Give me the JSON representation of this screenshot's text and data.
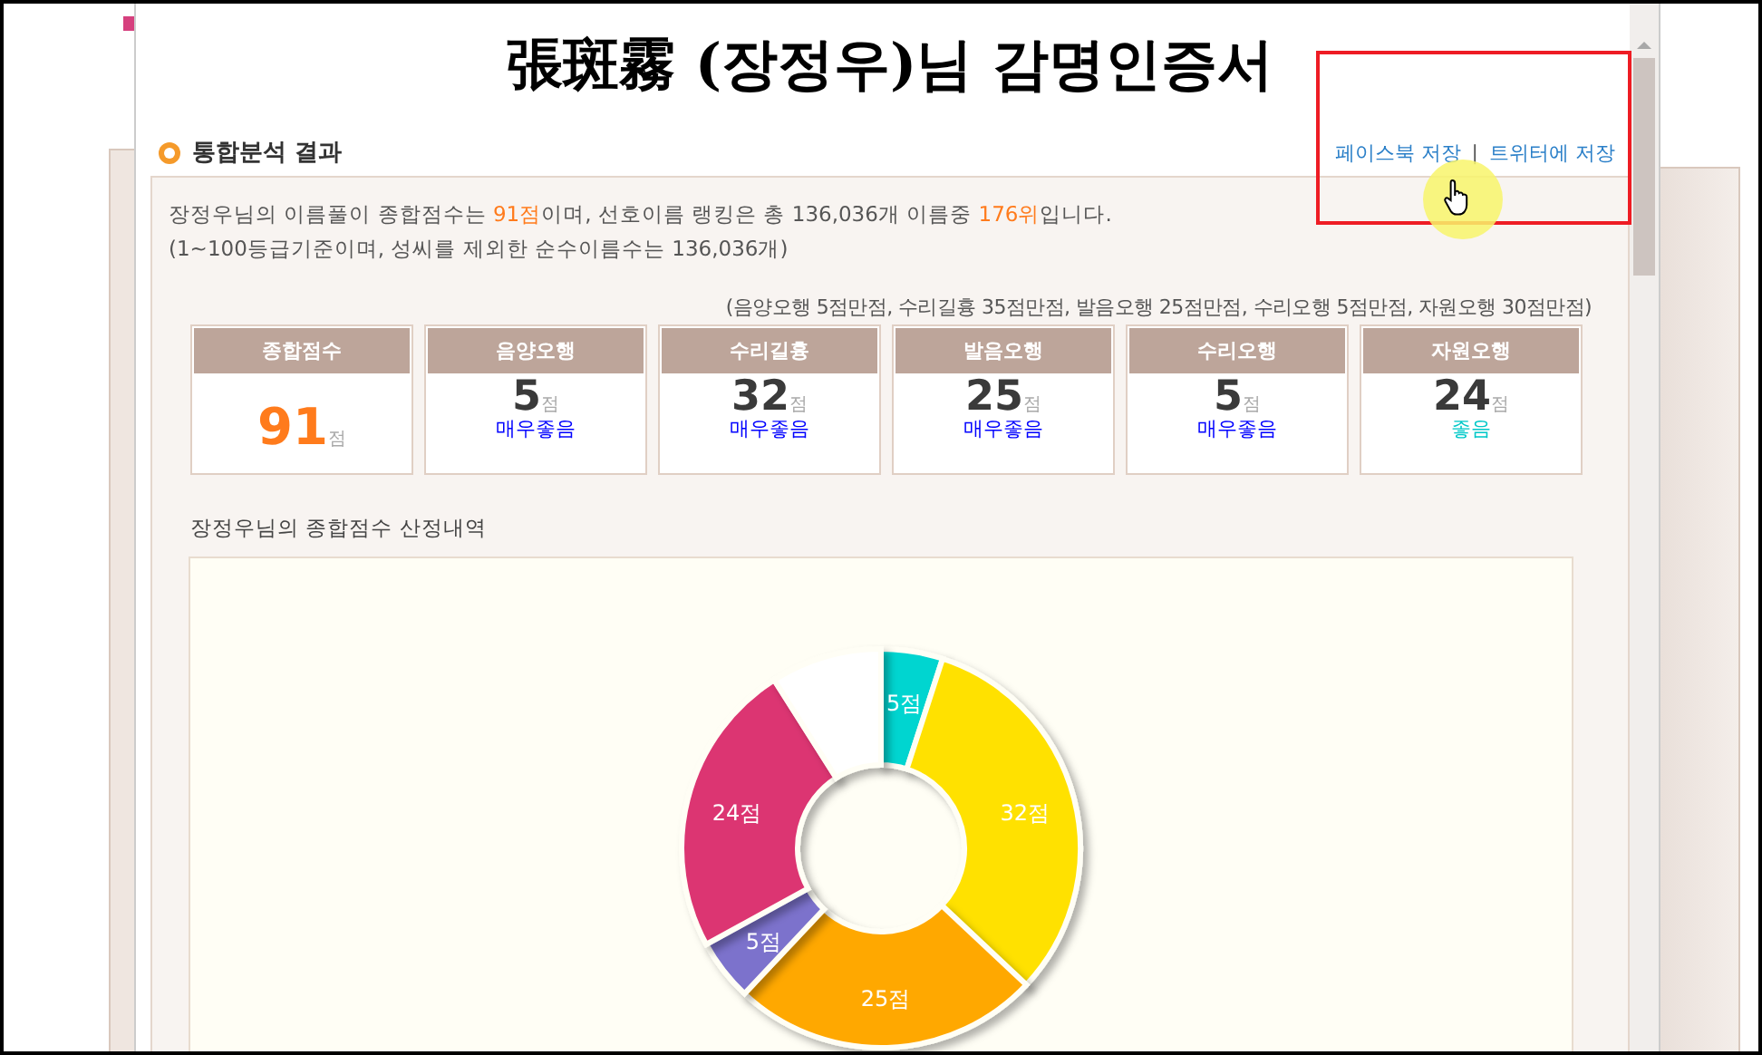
{
  "title": "張斑霧 (장정우)님 감명인증서",
  "section": {
    "title": "통합분석 결과",
    "links": [
      "페이스북 저장",
      "트위터에 저장"
    ],
    "separator": "|"
  },
  "summary": {
    "line1": "장정우님의 이름풀이 종합점수는 **91점**이며, 선호이름 랭킹은 총 136,036개 이름중 **176위**입니다.",
    "line2": "(1~100등급기준이며, 성씨를 제외한 순수이름수는 136,036개)"
  },
  "max_note": "(음양오행 5점만점, 수리길흉 35점만점, 발음오행 25점만점, 수리오행 5점만점, 자원오행 30점만점)",
  "cards": [
    {
      "kind": "total",
      "title": "종합점수",
      "score": "91",
      "unit": "점"
    },
    {
      "kind": "part",
      "title": "음양오행",
      "score": "5",
      "unit": "점",
      "grade": "매우좋음",
      "color": "#0000ff"
    },
    {
      "kind": "part",
      "title": "수리길흉",
      "score": "32",
      "unit": "점",
      "grade": "매우좋음",
      "color": "#0000ff"
    },
    {
      "kind": "part",
      "title": "발음오행",
      "score": "25",
      "unit": "점",
      "grade": "매우좋음",
      "color": "#0000ff"
    },
    {
      "kind": "part",
      "title": "수리오행",
      "score": "5",
      "unit": "점",
      "grade": "매우좋음",
      "color": "#0000ff"
    },
    {
      "kind": "part",
      "title": "자원오행",
      "score": "24",
      "unit": "점",
      "grade": "좋음",
      "color": "#00c8c8"
    }
  ],
  "breakdown": {
    "title": "장정우님의 종합점수 산정내역",
    "chart_data": {
      "type": "donut",
      "values": [
        5,
        32,
        25,
        5,
        24,
        9
      ],
      "colors": [
        "#00d5d0",
        "#ffe100",
        "#ffa800",
        "#7b72cc",
        "#dc3672",
        "#ffffff"
      ],
      "value_labels": [
        "5점",
        "32점",
        "25점",
        "5점",
        "24점",
        null
      ]
    }
  }
}
